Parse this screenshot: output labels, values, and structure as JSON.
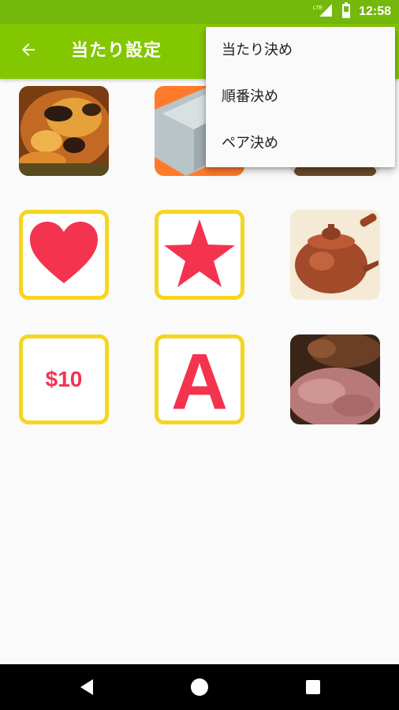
{
  "status_bar": {
    "time": "12:58",
    "network_label": "LTE"
  },
  "app_bar": {
    "title": "当たり設定",
    "back_icon": "arrow-left-icon"
  },
  "popup_menu": {
    "items": [
      {
        "label": "当たり決め"
      },
      {
        "label": "順番決め"
      },
      {
        "label": "ペア決め"
      }
    ]
  },
  "grid": {
    "items": [
      {
        "type": "photo",
        "subject": "roast-chicken"
      },
      {
        "type": "photo",
        "subject": "gift-box"
      },
      {
        "type": "photo",
        "subject": "food-bowl"
      },
      {
        "type": "icon-card",
        "icon": "heart-icon"
      },
      {
        "type": "icon-card",
        "icon": "star-icon"
      },
      {
        "type": "photo",
        "subject": "teapot"
      },
      {
        "type": "text-card",
        "text": "$10"
      },
      {
        "type": "icon-card",
        "icon": "letter-a-icon",
        "text": "A"
      },
      {
        "type": "photo",
        "subject": "grilled-meat"
      }
    ]
  },
  "colors": {
    "app_bar": "#83c701",
    "status_bar": "#73b80a",
    "card_border": "#f7d51d",
    "accent_red": "#f4334f"
  },
  "nav_bar": {
    "icons": [
      "back-triangle-icon",
      "home-circle-icon",
      "recents-square-icon"
    ]
  }
}
